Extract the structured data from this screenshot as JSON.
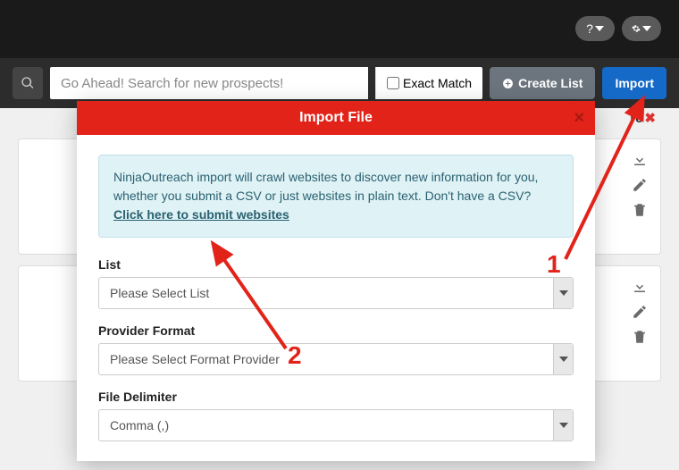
{
  "topbar": {
    "help_label": "?",
    "settings_label": ""
  },
  "search": {
    "placeholder": "Go Ahead! Search for new prospects!",
    "exact_match_label": "Exact Match"
  },
  "buttons": {
    "create_list": "Create List",
    "import": "Import"
  },
  "brand_fragment": {
    "text": "re",
    "suffix": "✖"
  },
  "modal": {
    "title": "Import File",
    "info_text": "NinjaOutreach import will crawl websites to discover new information for you, whether you submit a CSV or just websites in plain text. Don't have a CSV? ",
    "info_link": "Click here to submit websites",
    "fields": {
      "list": {
        "label": "List",
        "value": "Please Select List"
      },
      "provider": {
        "label": "Provider Format",
        "value": "Please Select Format Provider"
      },
      "delimiter": {
        "label": "File Delimiter",
        "value": "Comma (,)"
      }
    }
  },
  "annotations": {
    "num1": "1",
    "num2": "2"
  }
}
